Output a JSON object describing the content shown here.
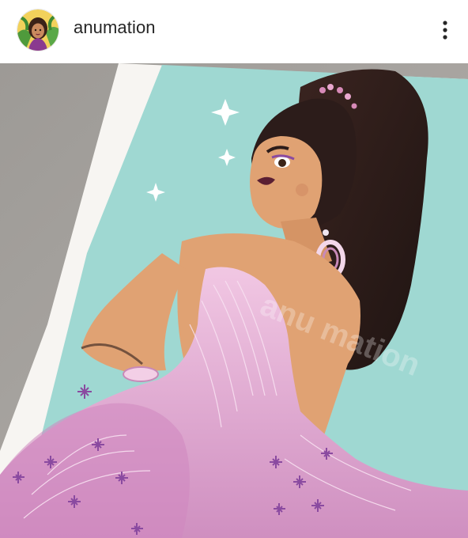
{
  "post": {
    "username": "anumation",
    "more_icon": "more-vertical-icon",
    "avatar_icon": "profile-avatar"
  },
  "photo": {
    "watermark": "anu mation"
  },
  "colors": {
    "background": "#ffffff",
    "username_text": "#262626",
    "table_gray": "#a5a19d",
    "print_border": "#f7f5f2",
    "mint_background": "#9fd8d2",
    "gown_pink": "#e8b2d6",
    "hair": "#2c1c1a",
    "skin": "#e0a273"
  }
}
